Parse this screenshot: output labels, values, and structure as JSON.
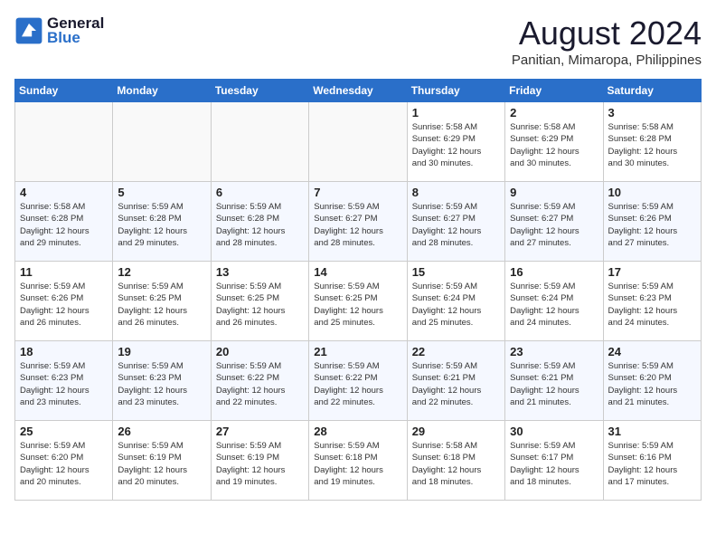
{
  "header": {
    "logo_line1": "General",
    "logo_line2": "Blue",
    "month_title": "August 2024",
    "location": "Panitian, Mimaropa, Philippines"
  },
  "days_of_week": [
    "Sunday",
    "Monday",
    "Tuesday",
    "Wednesday",
    "Thursday",
    "Friday",
    "Saturday"
  ],
  "weeks": [
    [
      {
        "day": "",
        "info": ""
      },
      {
        "day": "",
        "info": ""
      },
      {
        "day": "",
        "info": ""
      },
      {
        "day": "",
        "info": ""
      },
      {
        "day": "1",
        "info": "Sunrise: 5:58 AM\nSunset: 6:29 PM\nDaylight: 12 hours\nand 30 minutes."
      },
      {
        "day": "2",
        "info": "Sunrise: 5:58 AM\nSunset: 6:29 PM\nDaylight: 12 hours\nand 30 minutes."
      },
      {
        "day": "3",
        "info": "Sunrise: 5:58 AM\nSunset: 6:28 PM\nDaylight: 12 hours\nand 30 minutes."
      }
    ],
    [
      {
        "day": "4",
        "info": "Sunrise: 5:58 AM\nSunset: 6:28 PM\nDaylight: 12 hours\nand 29 minutes."
      },
      {
        "day": "5",
        "info": "Sunrise: 5:59 AM\nSunset: 6:28 PM\nDaylight: 12 hours\nand 29 minutes."
      },
      {
        "day": "6",
        "info": "Sunrise: 5:59 AM\nSunset: 6:28 PM\nDaylight: 12 hours\nand 28 minutes."
      },
      {
        "day": "7",
        "info": "Sunrise: 5:59 AM\nSunset: 6:27 PM\nDaylight: 12 hours\nand 28 minutes."
      },
      {
        "day": "8",
        "info": "Sunrise: 5:59 AM\nSunset: 6:27 PM\nDaylight: 12 hours\nand 28 minutes."
      },
      {
        "day": "9",
        "info": "Sunrise: 5:59 AM\nSunset: 6:27 PM\nDaylight: 12 hours\nand 27 minutes."
      },
      {
        "day": "10",
        "info": "Sunrise: 5:59 AM\nSunset: 6:26 PM\nDaylight: 12 hours\nand 27 minutes."
      }
    ],
    [
      {
        "day": "11",
        "info": "Sunrise: 5:59 AM\nSunset: 6:26 PM\nDaylight: 12 hours\nand 26 minutes."
      },
      {
        "day": "12",
        "info": "Sunrise: 5:59 AM\nSunset: 6:25 PM\nDaylight: 12 hours\nand 26 minutes."
      },
      {
        "day": "13",
        "info": "Sunrise: 5:59 AM\nSunset: 6:25 PM\nDaylight: 12 hours\nand 26 minutes."
      },
      {
        "day": "14",
        "info": "Sunrise: 5:59 AM\nSunset: 6:25 PM\nDaylight: 12 hours\nand 25 minutes."
      },
      {
        "day": "15",
        "info": "Sunrise: 5:59 AM\nSunset: 6:24 PM\nDaylight: 12 hours\nand 25 minutes."
      },
      {
        "day": "16",
        "info": "Sunrise: 5:59 AM\nSunset: 6:24 PM\nDaylight: 12 hours\nand 24 minutes."
      },
      {
        "day": "17",
        "info": "Sunrise: 5:59 AM\nSunset: 6:23 PM\nDaylight: 12 hours\nand 24 minutes."
      }
    ],
    [
      {
        "day": "18",
        "info": "Sunrise: 5:59 AM\nSunset: 6:23 PM\nDaylight: 12 hours\nand 23 minutes."
      },
      {
        "day": "19",
        "info": "Sunrise: 5:59 AM\nSunset: 6:23 PM\nDaylight: 12 hours\nand 23 minutes."
      },
      {
        "day": "20",
        "info": "Sunrise: 5:59 AM\nSunset: 6:22 PM\nDaylight: 12 hours\nand 22 minutes."
      },
      {
        "day": "21",
        "info": "Sunrise: 5:59 AM\nSunset: 6:22 PM\nDaylight: 12 hours\nand 22 minutes."
      },
      {
        "day": "22",
        "info": "Sunrise: 5:59 AM\nSunset: 6:21 PM\nDaylight: 12 hours\nand 22 minutes."
      },
      {
        "day": "23",
        "info": "Sunrise: 5:59 AM\nSunset: 6:21 PM\nDaylight: 12 hours\nand 21 minutes."
      },
      {
        "day": "24",
        "info": "Sunrise: 5:59 AM\nSunset: 6:20 PM\nDaylight: 12 hours\nand 21 minutes."
      }
    ],
    [
      {
        "day": "25",
        "info": "Sunrise: 5:59 AM\nSunset: 6:20 PM\nDaylight: 12 hours\nand 20 minutes."
      },
      {
        "day": "26",
        "info": "Sunrise: 5:59 AM\nSunset: 6:19 PM\nDaylight: 12 hours\nand 20 minutes."
      },
      {
        "day": "27",
        "info": "Sunrise: 5:59 AM\nSunset: 6:19 PM\nDaylight: 12 hours\nand 19 minutes."
      },
      {
        "day": "28",
        "info": "Sunrise: 5:59 AM\nSunset: 6:18 PM\nDaylight: 12 hours\nand 19 minutes."
      },
      {
        "day": "29",
        "info": "Sunrise: 5:58 AM\nSunset: 6:18 PM\nDaylight: 12 hours\nand 18 minutes."
      },
      {
        "day": "30",
        "info": "Sunrise: 5:59 AM\nSunset: 6:17 PM\nDaylight: 12 hours\nand 18 minutes."
      },
      {
        "day": "31",
        "info": "Sunrise: 5:59 AM\nSunset: 6:16 PM\nDaylight: 12 hours\nand 17 minutes."
      }
    ]
  ]
}
